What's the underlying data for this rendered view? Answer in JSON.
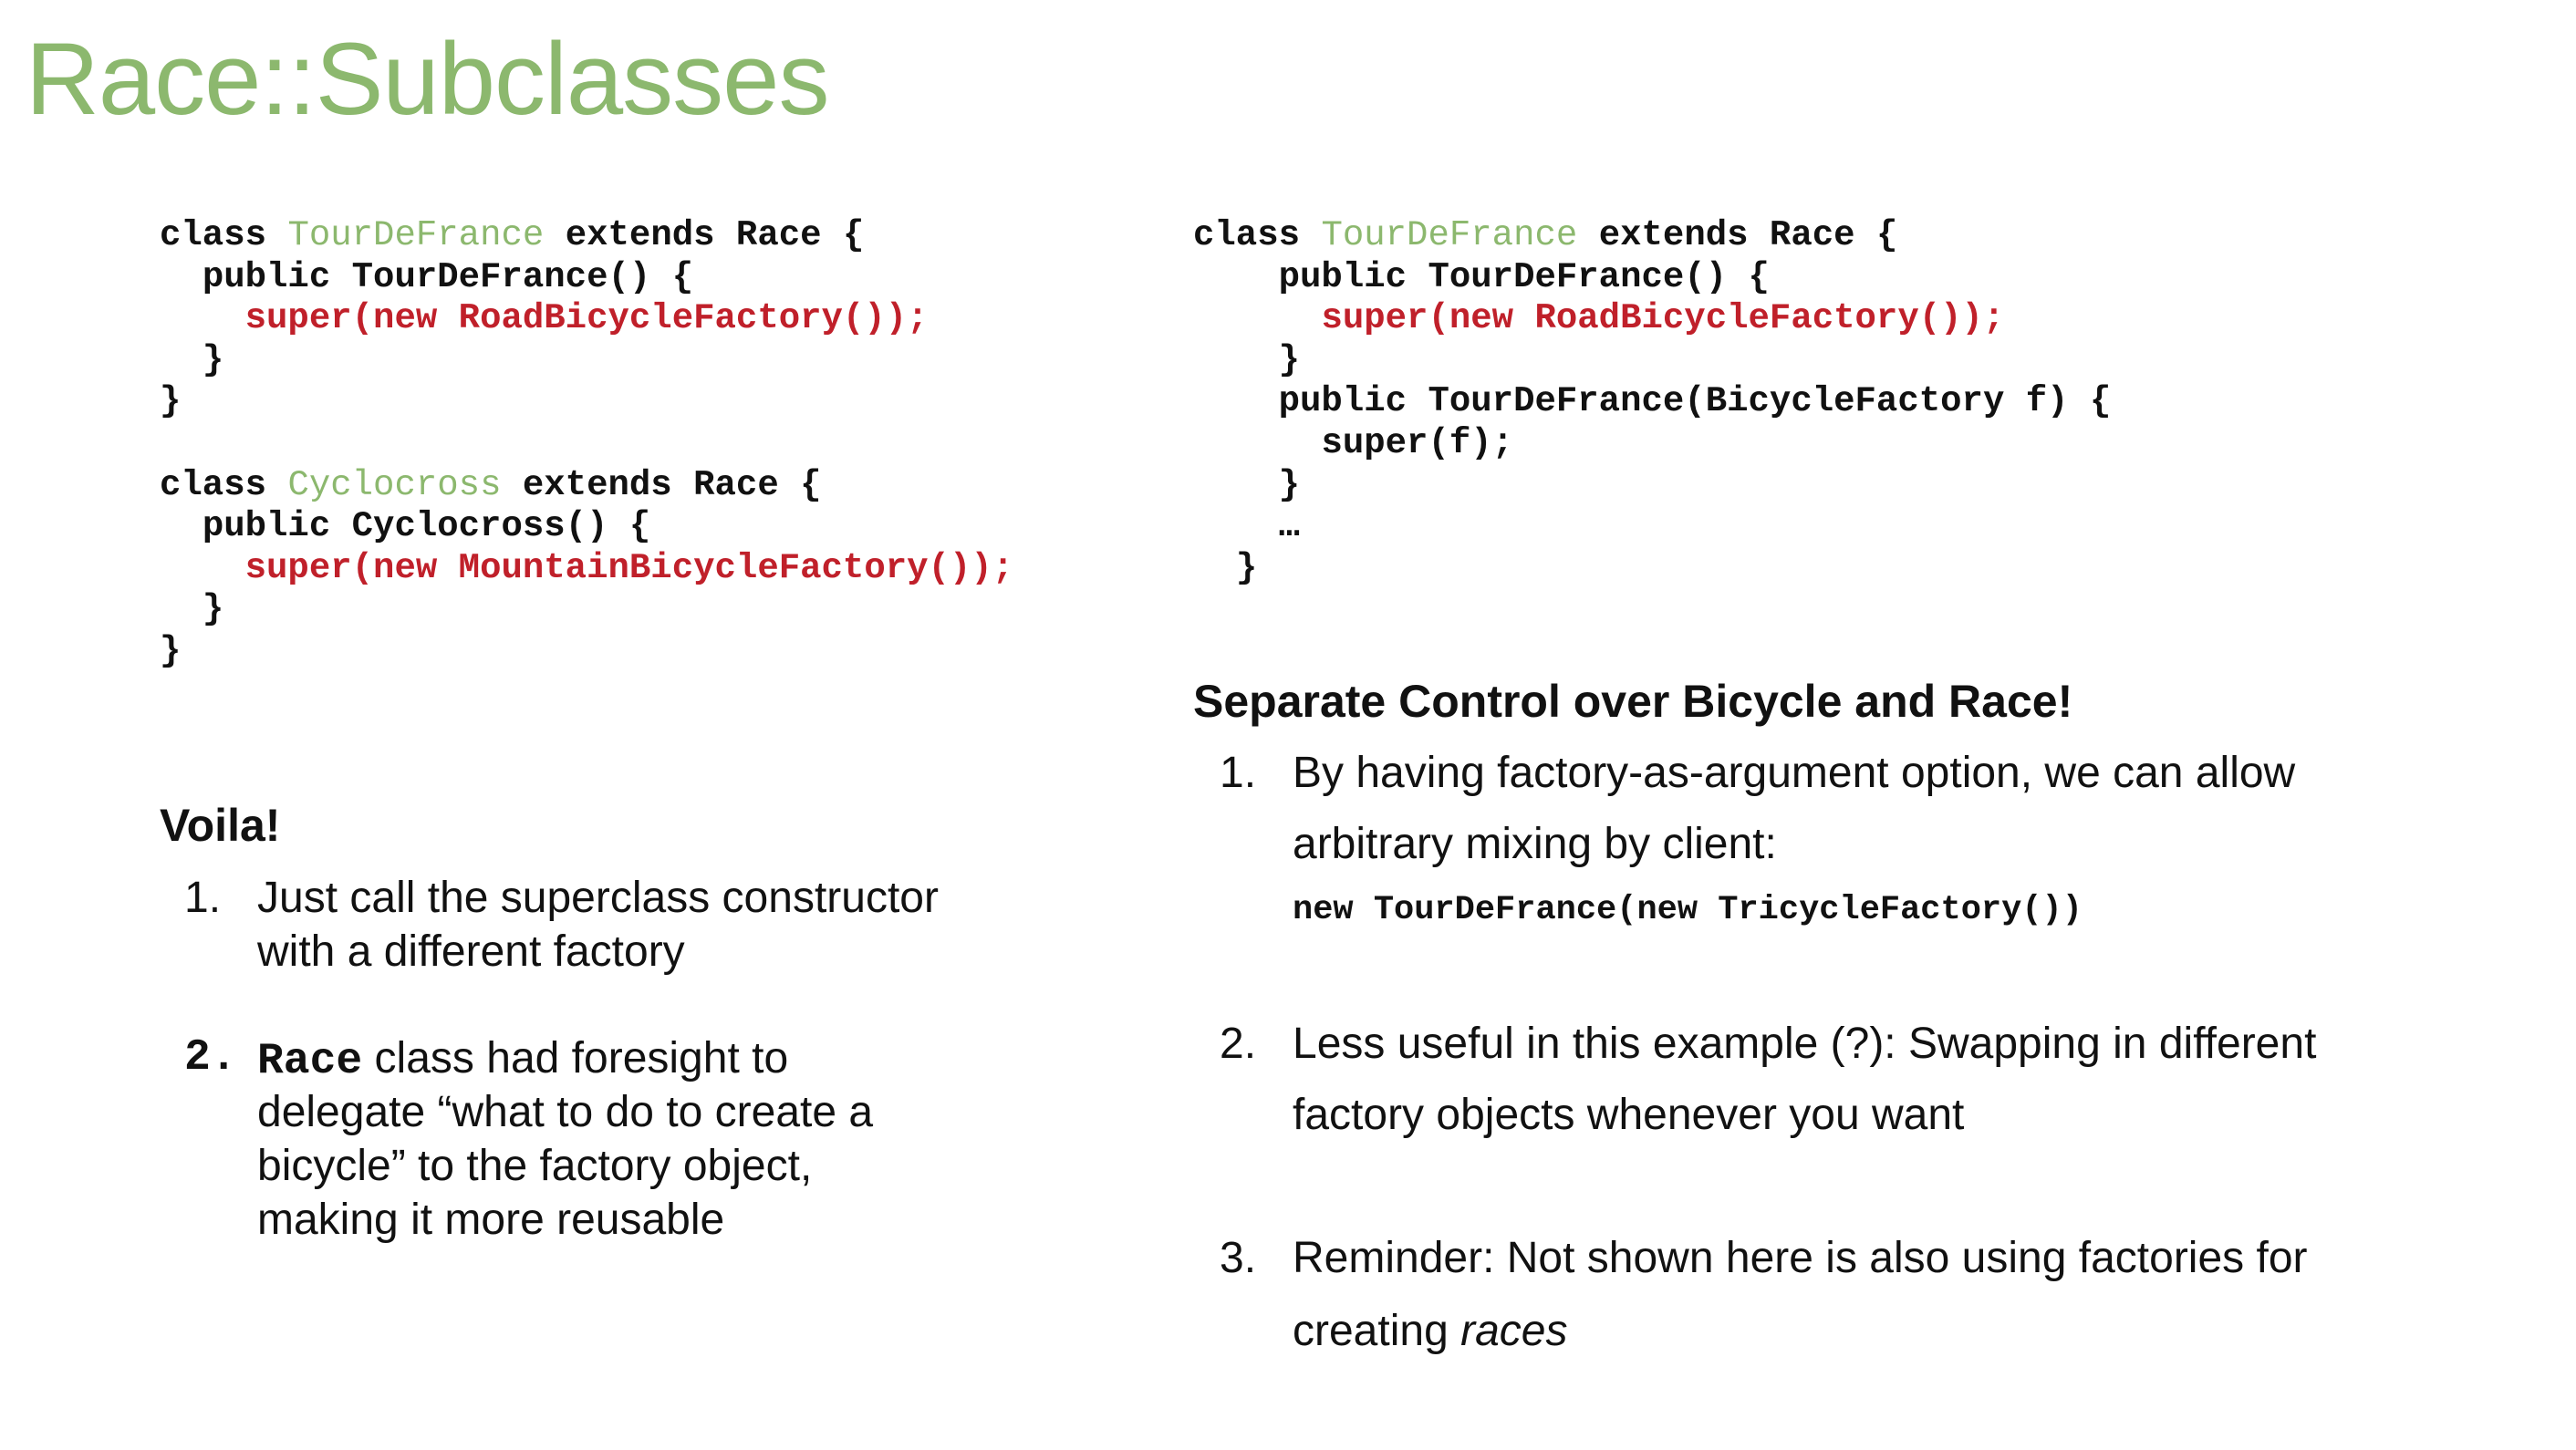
{
  "title": "Race::Subclasses",
  "colors": {
    "title": "#8cb86e",
    "class_name": "#8cb86e",
    "super_call": "#c0202a",
    "text": "#111111"
  },
  "left_code": [
    {
      "indent": "",
      "parts": [
        {
          "t": "class ",
          "c": ""
        },
        {
          "t": "TourDeFrance",
          "c": "g"
        },
        {
          "t": " extends Race {",
          "c": ""
        }
      ]
    },
    {
      "indent": "  ",
      "parts": [
        {
          "t": "public TourDeFrance() {",
          "c": ""
        }
      ]
    },
    {
      "indent": "    ",
      "parts": [
        {
          "t": "super(new RoadBicycleFactory());",
          "c": "r"
        }
      ]
    },
    {
      "indent": "  ",
      "parts": [
        {
          "t": "}",
          "c": ""
        }
      ]
    },
    {
      "indent": "",
      "parts": [
        {
          "t": "}",
          "c": ""
        }
      ]
    },
    {
      "indent": "",
      "parts": []
    },
    {
      "indent": "",
      "parts": [
        {
          "t": "class ",
          "c": ""
        },
        {
          "t": "Cyclocross",
          "c": "g"
        },
        {
          "t": " extends Race {",
          "c": ""
        }
      ]
    },
    {
      "indent": "  ",
      "parts": [
        {
          "t": "public Cyclocross() {",
          "c": ""
        }
      ]
    },
    {
      "indent": "    ",
      "parts": [
        {
          "t": "super(new MountainBicycleFactory());",
          "c": "r"
        }
      ]
    },
    {
      "indent": "  ",
      "parts": [
        {
          "t": "}",
          "c": ""
        }
      ]
    },
    {
      "indent": "",
      "parts": [
        {
          "t": "}",
          "c": ""
        }
      ]
    }
  ],
  "right_code": [
    {
      "indent": "",
      "parts": [
        {
          "t": "class ",
          "c": ""
        },
        {
          "t": "TourDeFrance",
          "c": "g"
        },
        {
          "t": " extends Race {",
          "c": ""
        }
      ]
    },
    {
      "indent": "    ",
      "parts": [
        {
          "t": "public TourDeFrance() {",
          "c": ""
        }
      ]
    },
    {
      "indent": "      ",
      "parts": [
        {
          "t": "super(new RoadBicycleFactory());",
          "c": "r"
        }
      ]
    },
    {
      "indent": "    ",
      "parts": [
        {
          "t": "}",
          "c": ""
        }
      ]
    },
    {
      "indent": "    ",
      "parts": [
        {
          "t": "public TourDeFrance(BicycleFactory f) {",
          "c": ""
        }
      ]
    },
    {
      "indent": "      ",
      "parts": [
        {
          "t": "super(f);",
          "c": ""
        }
      ]
    },
    {
      "indent": "    ",
      "parts": [
        {
          "t": "}",
          "c": ""
        }
      ]
    },
    {
      "indent": "    ",
      "parts": [
        {
          "t": "…",
          "c": ""
        }
      ]
    },
    {
      "indent": "  ",
      "parts": [
        {
          "t": "}",
          "c": ""
        }
      ]
    }
  ],
  "left_section": {
    "heading": "Voila!",
    "item1": {
      "num": "1.",
      "lines": [
        "Just call the superclass constructor",
        "with a different factory"
      ]
    },
    "item2": {
      "num": "2.",
      "code_word": "Race",
      "first_line_rest": " class had foresight to",
      "lines": [
        "delegate “what to do to create a",
        "bicycle” to the factory object,",
        "making it more reusable"
      ]
    }
  },
  "right_section": {
    "heading": "Separate Control over Bicycle and Race!",
    "item1": {
      "num": "1.",
      "lines": [
        "By having factory-as-argument option, we can allow",
        "arbitrary mixing by client:"
      ],
      "code": "new TourDeFrance(new TricycleFactory())"
    },
    "item2": {
      "num": "2.",
      "lines": [
        "Less useful in this example (?): Swapping in different",
        "factory objects whenever you want"
      ]
    },
    "item3": {
      "num": "3.",
      "lines": [
        "Reminder: Not shown here is also using factories for"
      ],
      "line2_prefix": "creating ",
      "line2_italic": "races"
    }
  }
}
